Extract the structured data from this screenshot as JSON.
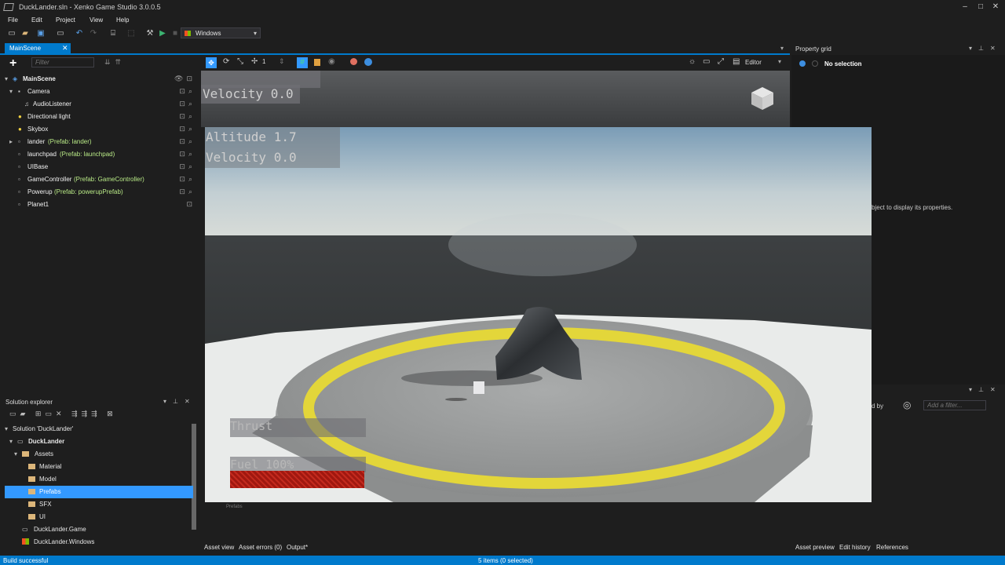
{
  "window": {
    "title": "DuckLander.sln - Xenko Game Studio 3.0.0.5",
    "min": "–",
    "max": "□",
    "close": "✕"
  },
  "menu": [
    "File",
    "Edit",
    "Project",
    "View",
    "Help"
  ],
  "toolbar": {
    "platform": "Windows"
  },
  "tabs": {
    "scene": "MainScene"
  },
  "hierarchy": {
    "filter_placeholder": "Filter",
    "items": [
      {
        "label": "MainScene",
        "prefab": ""
      },
      {
        "label": "Camera",
        "prefab": ""
      },
      {
        "label": "AudioListener",
        "prefab": ""
      },
      {
        "label": "Directional light",
        "prefab": ""
      },
      {
        "label": "Skybox",
        "prefab": ""
      },
      {
        "label": "lander",
        "prefab": "(Prefab: lander)"
      },
      {
        "label": "launchpad",
        "prefab": "(Prefab: launchpad)"
      },
      {
        "label": "UIBase",
        "prefab": ""
      },
      {
        "label": "GameController",
        "prefab": "(Prefab: GameController)"
      },
      {
        "label": "Powerup",
        "prefab": "(Prefab: powerupPrefab)"
      },
      {
        "label": "Planet1",
        "prefab": ""
      }
    ]
  },
  "scene_toolbar": {
    "snap_value": "1",
    "mode": "Editor"
  },
  "property_grid": {
    "title": "Property grid",
    "status": "No selection",
    "hint": "bject to display its properties."
  },
  "asset_panel": {
    "filter_placeholder": "Add a filter...",
    "sorted_by": "d by",
    "folder": "Prefabs"
  },
  "solution_explorer": {
    "title": "Solution explorer",
    "items": [
      "Solution 'DuckLander'",
      "DuckLander",
      "Assets",
      "Material",
      "Model",
      "Prefabs",
      "SFX",
      "UI",
      "DuckLander.Game",
      "DuckLander.Windows"
    ]
  },
  "bottom_tabs": {
    "left": [
      "Asset view",
      "Asset errors (0)",
      "Output*"
    ],
    "right": [
      "Asset preview",
      "Edit history",
      "References"
    ]
  },
  "status": {
    "left": "Build successful",
    "center": "5 items (0 selected)"
  },
  "game": {
    "behind_velocity": "Velocity 0.0",
    "altitude": "Altitude 1.7",
    "velocity": "Velocity 0.0",
    "thrust": "Thrust",
    "fuel": "Fuel 100%",
    "fuel_level": 1.0
  },
  "colors": {
    "accent": "#007acc",
    "selection": "#3399ff",
    "prefab_text": "#b8e986",
    "ring": "#e3d63a",
    "fuel": "#a01810"
  }
}
